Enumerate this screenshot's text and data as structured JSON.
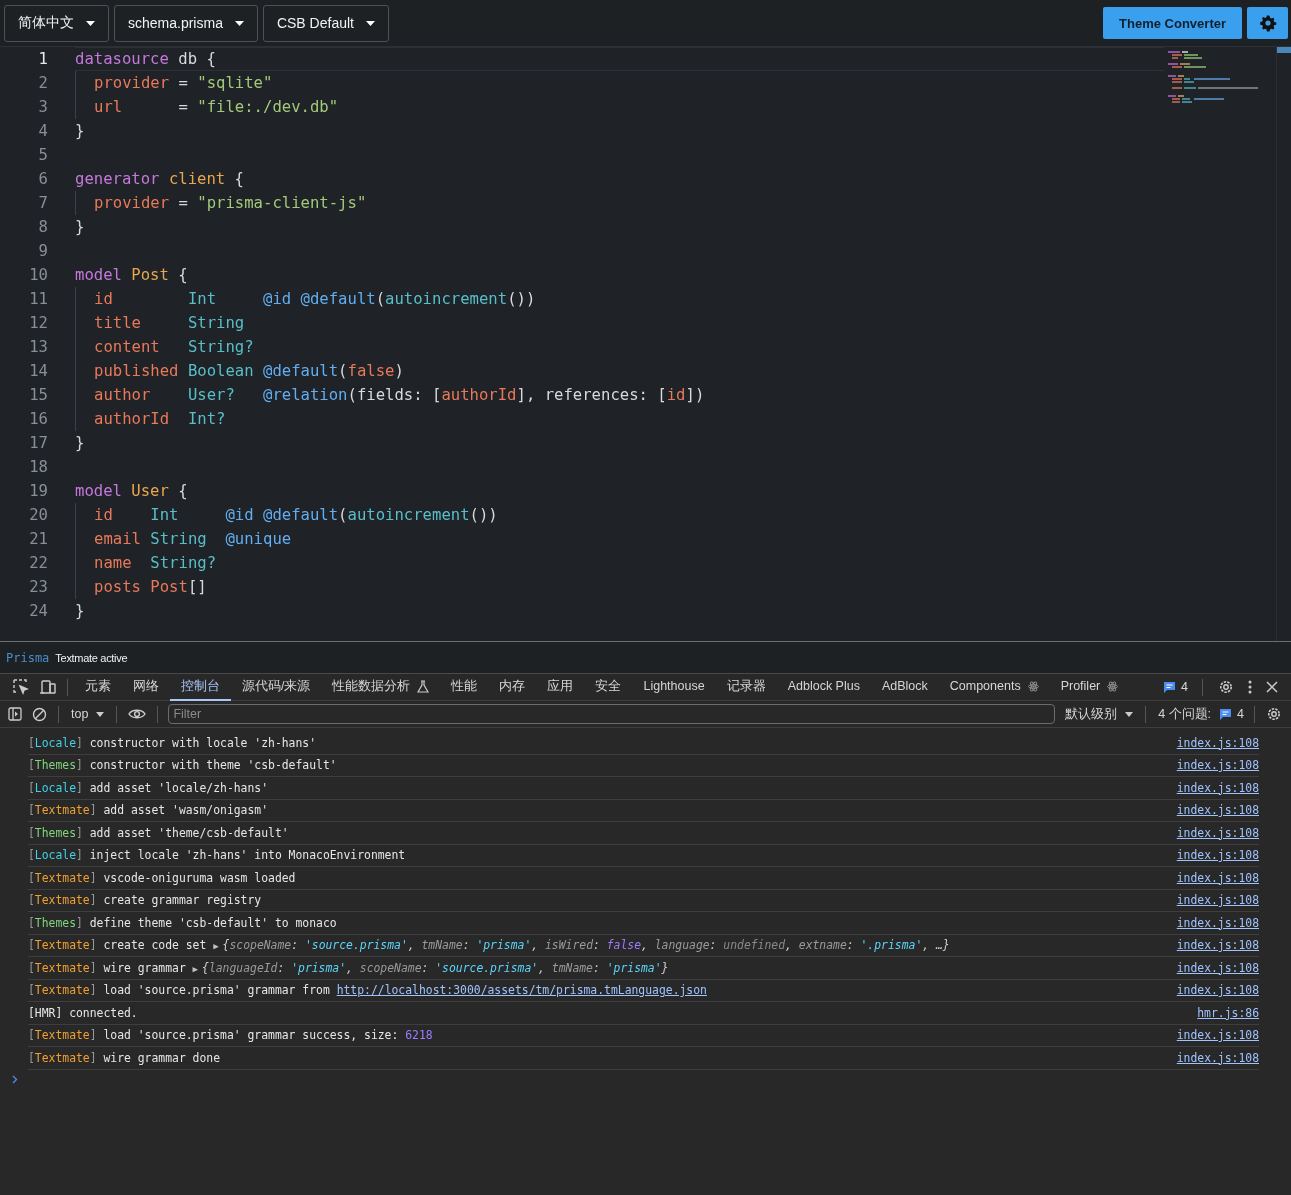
{
  "toolbar": {
    "dropdowns": [
      {
        "label": "简体中文"
      },
      {
        "label": "schema.prisma"
      },
      {
        "label": "CSB Default"
      }
    ],
    "converter_button": "Theme Converter"
  },
  "editor": {
    "lines": [
      {
        "number": "1",
        "current": true,
        "guide": false,
        "tokens": [
          {
            "kind": "keyword",
            "text": "datasource"
          },
          {
            "kind": "plain",
            "text": " db {"
          }
        ]
      },
      {
        "number": "2",
        "current": false,
        "guide": true,
        "tokens": [
          {
            "kind": "field",
            "text": "provider"
          },
          {
            "kind": "plain",
            "text": " = "
          },
          {
            "kind": "string",
            "text": "\"sqlite\""
          }
        ]
      },
      {
        "number": "3",
        "current": false,
        "guide": true,
        "tokens": [
          {
            "kind": "field",
            "text": "url"
          },
          {
            "kind": "plain",
            "text": "      = "
          },
          {
            "kind": "string",
            "text": "\"file:./dev.db\""
          }
        ]
      },
      {
        "number": "4",
        "current": false,
        "guide": false,
        "tokens": [
          {
            "kind": "plain",
            "text": "}"
          }
        ]
      },
      {
        "number": "5",
        "current": false,
        "guide": false
      },
      {
        "number": "6",
        "current": false,
        "guide": false,
        "tokens": [
          {
            "kind": "keyword",
            "text": "generator"
          },
          {
            "kind": "name",
            "text": " client"
          },
          {
            "kind": "plain",
            "text": " {"
          }
        ]
      },
      {
        "number": "7",
        "current": false,
        "guide": true,
        "tokens": [
          {
            "kind": "field",
            "text": "provider"
          },
          {
            "kind": "plain",
            "text": " = "
          },
          {
            "kind": "string",
            "text": "\"prisma-client-js\""
          }
        ]
      },
      {
        "number": "8",
        "current": false,
        "guide": false,
        "tokens": [
          {
            "kind": "plain",
            "text": "}"
          }
        ]
      },
      {
        "number": "9",
        "current": false,
        "guide": false
      },
      {
        "number": "10",
        "current": false,
        "guide": false,
        "tokens": [
          {
            "kind": "keyword",
            "text": "model"
          },
          {
            "kind": "name",
            "text": " Post"
          },
          {
            "kind": "plain",
            "text": " {"
          }
        ]
      },
      {
        "number": "11",
        "current": false,
        "guide": true,
        "tokens": [
          {
            "kind": "field",
            "text": "id"
          },
          {
            "kind": "type",
            "text": "        Int"
          },
          {
            "kind": "attr",
            "text": "     @id"
          },
          {
            "kind": "attr",
            "text": " @default"
          },
          {
            "kind": "plain",
            "text": "("
          },
          {
            "kind": "func",
            "text": "autoincrement"
          },
          {
            "kind": "plain",
            "text": "())"
          }
        ]
      },
      {
        "number": "12",
        "current": false,
        "guide": true,
        "tokens": [
          {
            "kind": "field",
            "text": "title"
          },
          {
            "kind": "type",
            "text": "     String"
          }
        ]
      },
      {
        "number": "13",
        "current": false,
        "guide": true,
        "tokens": [
          {
            "kind": "field",
            "text": "content"
          },
          {
            "kind": "type",
            "text": "   String?"
          }
        ]
      },
      {
        "number": "14",
        "current": false,
        "guide": true,
        "tokens": [
          {
            "kind": "field",
            "text": "published"
          },
          {
            "kind": "type",
            "text": " Boolean"
          },
          {
            "kind": "attr",
            "text": " @default"
          },
          {
            "kind": "plain",
            "text": "("
          },
          {
            "kind": "literal",
            "text": "false"
          },
          {
            "kind": "plain",
            "text": ")"
          }
        ]
      },
      {
        "number": "15",
        "current": false,
        "guide": true,
        "tokens": [
          {
            "kind": "field",
            "text": "author"
          },
          {
            "kind": "type",
            "text": "    User?"
          },
          {
            "kind": "attr",
            "text": "   @relation"
          },
          {
            "kind": "plain",
            "text": "(fields: ["
          },
          {
            "kind": "field",
            "text": "authorId"
          },
          {
            "kind": "plain",
            "text": "], references: ["
          },
          {
            "kind": "field",
            "text": "id"
          },
          {
            "kind": "plain",
            "text": "])"
          }
        ]
      },
      {
        "number": "16",
        "current": false,
        "guide": true,
        "tokens": [
          {
            "kind": "field",
            "text": "authorId"
          },
          {
            "kind": "type",
            "text": "  Int?"
          }
        ]
      },
      {
        "number": "17",
        "current": false,
        "guide": false,
        "tokens": [
          {
            "kind": "plain",
            "text": "}"
          }
        ]
      },
      {
        "number": "18",
        "current": false,
        "guide": false
      },
      {
        "number": "19",
        "current": false,
        "guide": false,
        "tokens": [
          {
            "kind": "keyword",
            "text": "model"
          },
          {
            "kind": "name",
            "text": " User"
          },
          {
            "kind": "plain",
            "text": " {"
          }
        ]
      },
      {
        "number": "20",
        "current": false,
        "guide": true,
        "tokens": [
          {
            "kind": "field",
            "text": "id"
          },
          {
            "kind": "type",
            "text": "    Int"
          },
          {
            "kind": "attr",
            "text": "     @id"
          },
          {
            "kind": "attr",
            "text": " @default"
          },
          {
            "kind": "plain",
            "text": "("
          },
          {
            "kind": "func",
            "text": "autoincrement"
          },
          {
            "kind": "plain",
            "text": "())"
          }
        ]
      },
      {
        "number": "21",
        "current": false,
        "guide": true,
        "tokens": [
          {
            "kind": "field",
            "text": "email"
          },
          {
            "kind": "type",
            "text": " String"
          },
          {
            "kind": "attr",
            "text": "  @unique"
          }
        ]
      },
      {
        "number": "22",
        "current": false,
        "guide": true,
        "tokens": [
          {
            "kind": "field",
            "text": "name"
          },
          {
            "kind": "type",
            "text": "  String?"
          }
        ]
      },
      {
        "number": "23",
        "current": false,
        "guide": true,
        "tokens": [
          {
            "kind": "field",
            "text": "posts"
          },
          {
            "kind": "field",
            "text": " Post"
          },
          {
            "kind": "plain",
            "text": "[]"
          }
        ]
      },
      {
        "number": "24",
        "current": false,
        "guide": false,
        "tokens": [
          {
            "kind": "plain",
            "text": "}"
          }
        ]
      }
    ]
  },
  "status_bar": {
    "language": "Prisma",
    "message": "Textmate active"
  },
  "devtools": {
    "tabs": [
      {
        "label": "元素",
        "selected": false,
        "kind": "panel"
      },
      {
        "label": "网络",
        "selected": false,
        "kind": "panel"
      },
      {
        "label": "控制台",
        "selected": true,
        "kind": "panel"
      },
      {
        "label": "源代码/来源",
        "selected": false,
        "kind": "panel"
      },
      {
        "label": "性能数据分析",
        "selected": false,
        "kind": "experimental"
      },
      {
        "label": "性能",
        "selected": false,
        "kind": "panel"
      },
      {
        "label": "内存",
        "selected": false,
        "kind": "panel"
      },
      {
        "label": "应用",
        "selected": false,
        "kind": "panel"
      },
      {
        "label": "安全",
        "selected": false,
        "kind": "panel"
      },
      {
        "label": "Lighthouse",
        "selected": false,
        "kind": "panel"
      },
      {
        "label": "记录器",
        "selected": false,
        "kind": "panel"
      },
      {
        "label": "Adblock Plus",
        "selected": false,
        "kind": "panel"
      },
      {
        "label": "AdBlock",
        "selected": false,
        "kind": "panel"
      },
      {
        "label": "Components",
        "selected": false,
        "kind": "extension"
      },
      {
        "label": "Profiler",
        "selected": false,
        "kind": "extension"
      }
    ],
    "issues_count": "4",
    "console_toolbar": {
      "context": "top",
      "filter_placeholder": "Filter",
      "level": "默认级别",
      "issues_label": "4 个问题:",
      "issues_count": "4"
    },
    "messages": [
      {
        "color": "#41d3e8",
        "parts": [
          {
            "kind": "bracket",
            "text": "["
          },
          {
            "kind": "tag",
            "text": "Locale"
          },
          {
            "kind": "bracket",
            "text": "]"
          },
          {
            "kind": "text",
            "text": " constructor with locale 'zh-hans'"
          }
        ],
        "source": "index.js:108"
      },
      {
        "color": "#7fd67a",
        "parts": [
          {
            "kind": "bracket",
            "text": "["
          },
          {
            "kind": "tag",
            "text": "Themes"
          },
          {
            "kind": "bracket",
            "text": "]"
          },
          {
            "kind": "text",
            "text": " constructor with theme 'csb-default'"
          }
        ],
        "source": "index.js:108"
      },
      {
        "color": "#41d3e8",
        "parts": [
          {
            "kind": "bracket",
            "text": "["
          },
          {
            "kind": "tag",
            "text": "Locale"
          },
          {
            "kind": "bracket",
            "text": "]"
          },
          {
            "kind": "text",
            "text": " add asset 'locale/zh-hans'"
          }
        ],
        "source": "index.js:108"
      },
      {
        "color": "#f0a030",
        "parts": [
          {
            "kind": "bracket",
            "text": "["
          },
          {
            "kind": "tag",
            "text": "Textmate"
          },
          {
            "kind": "bracket",
            "text": "]"
          },
          {
            "kind": "text",
            "text": " add asset 'wasm/onigasm'"
          }
        ],
        "source": "index.js:108"
      },
      {
        "color": "#7fd67a",
        "parts": [
          {
            "kind": "bracket",
            "text": "["
          },
          {
            "kind": "tag",
            "text": "Themes"
          },
          {
            "kind": "bracket",
            "text": "]"
          },
          {
            "kind": "text",
            "text": " add asset 'theme/csb-default'"
          }
        ],
        "source": "index.js:108"
      },
      {
        "color": "#41d3e8",
        "parts": [
          {
            "kind": "bracket",
            "text": "["
          },
          {
            "kind": "tag",
            "text": "Locale"
          },
          {
            "kind": "bracket",
            "text": "]"
          },
          {
            "kind": "text",
            "text": " inject locale 'zh-hans' into MonacoEnvironment"
          }
        ],
        "source": "index.js:108"
      },
      {
        "color": "#f0a030",
        "parts": [
          {
            "kind": "bracket",
            "text": "["
          },
          {
            "kind": "tag",
            "text": "Textmate"
          },
          {
            "kind": "bracket",
            "text": "]"
          },
          {
            "kind": "text",
            "text": " vscode-oniguruma wasm loaded"
          }
        ],
        "source": "index.js:108"
      },
      {
        "color": "#f0a030",
        "parts": [
          {
            "kind": "bracket",
            "text": "["
          },
          {
            "kind": "tag",
            "text": "Textmate"
          },
          {
            "kind": "bracket",
            "text": "]"
          },
          {
            "kind": "text",
            "text": " create grammar registry"
          }
        ],
        "source": "index.js:108"
      },
      {
        "color": "#7fd67a",
        "parts": [
          {
            "kind": "bracket",
            "text": "["
          },
          {
            "kind": "tag",
            "text": "Themes"
          },
          {
            "kind": "bracket",
            "text": "]"
          },
          {
            "kind": "text",
            "text": " define theme 'csb-default' to monaco"
          }
        ],
        "source": "index.js:108"
      },
      {
        "color": "#f0a030",
        "parts": [
          {
            "kind": "bracket",
            "text": "["
          },
          {
            "kind": "tag",
            "text": "Textmate"
          },
          {
            "kind": "bracket",
            "text": "]"
          },
          {
            "kind": "text",
            "text": " create code set "
          },
          {
            "kind": "expander",
            "text": "▶"
          },
          {
            "kind": "punct",
            "text": "{"
          },
          {
            "kind": "key",
            "text": "scopeName"
          },
          {
            "kind": "punct",
            "text": ": "
          },
          {
            "kind": "string",
            "text": "'source.prisma'"
          },
          {
            "kind": "punct",
            "text": ", "
          },
          {
            "kind": "key",
            "text": "tmName"
          },
          {
            "kind": "punct",
            "text": ": "
          },
          {
            "kind": "string",
            "text": "'prisma'"
          },
          {
            "kind": "punct",
            "text": ", "
          },
          {
            "kind": "key",
            "text": "isWired"
          },
          {
            "kind": "punct",
            "text": ": "
          },
          {
            "kind": "boolean",
            "text": "false"
          },
          {
            "kind": "punct",
            "text": ", "
          },
          {
            "kind": "key",
            "text": "language"
          },
          {
            "kind": "punct",
            "text": ": "
          },
          {
            "kind": "undefined",
            "text": "undefined"
          },
          {
            "kind": "punct",
            "text": ", "
          },
          {
            "kind": "key",
            "text": "extname"
          },
          {
            "kind": "punct",
            "text": ": "
          },
          {
            "kind": "string",
            "text": "'.prisma'"
          },
          {
            "kind": "punct",
            "text": ", …}"
          }
        ],
        "source": "index.js:108"
      },
      {
        "color": "#f0a030",
        "parts": [
          {
            "kind": "bracket",
            "text": "["
          },
          {
            "kind": "tag",
            "text": "Textmate"
          },
          {
            "kind": "bracket",
            "text": "]"
          },
          {
            "kind": "text",
            "text": " wire grammar "
          },
          {
            "kind": "expander",
            "text": "▶"
          },
          {
            "kind": "punct",
            "text": "{"
          },
          {
            "kind": "key",
            "text": "languageId"
          },
          {
            "kind": "punct",
            "text": ": "
          },
          {
            "kind": "string",
            "text": "'prisma'"
          },
          {
            "kind": "punct",
            "text": ", "
          },
          {
            "kind": "key",
            "text": "scopeName"
          },
          {
            "kind": "punct",
            "text": ": "
          },
          {
            "kind": "string",
            "text": "'source.prisma'"
          },
          {
            "kind": "punct",
            "text": ", "
          },
          {
            "kind": "key",
            "text": "tmName"
          },
          {
            "kind": "punct",
            "text": ": "
          },
          {
            "kind": "string",
            "text": "'prisma'"
          },
          {
            "kind": "punct",
            "text": "}"
          }
        ],
        "source": "index.js:108"
      },
      {
        "color": "#f0a030",
        "parts": [
          {
            "kind": "bracket",
            "text": "["
          },
          {
            "kind": "tag",
            "text": "Textmate"
          },
          {
            "kind": "bracket",
            "text": "]"
          },
          {
            "kind": "text",
            "text": " load 'source.prisma' grammar from "
          },
          {
            "kind": "link",
            "text": "http://localhost:3000/assets/tm/prisma.tmLanguage.json"
          }
        ],
        "source": "index.js:108"
      },
      {
        "parts": [
          {
            "kind": "text",
            "text": "[HMR] connected."
          }
        ],
        "source": "hmr.js:86"
      },
      {
        "color": "#f0a030",
        "parts": [
          {
            "kind": "bracket",
            "text": "["
          },
          {
            "kind": "tag",
            "text": "Textmate"
          },
          {
            "kind": "bracket",
            "text": "]"
          },
          {
            "kind": "text",
            "text": " load 'source.prisma' grammar success, size: "
          },
          {
            "kind": "number",
            "text": "6218"
          }
        ],
        "source": "index.js:108"
      },
      {
        "color": "#f0a030",
        "parts": [
          {
            "kind": "bracket",
            "text": "["
          },
          {
            "kind": "tag",
            "text": "Textmate"
          },
          {
            "kind": "bracket",
            "text": "]"
          },
          {
            "kind": "text",
            "text": " wire grammar done"
          }
        ],
        "source": "index.js:108"
      }
    ]
  }
}
